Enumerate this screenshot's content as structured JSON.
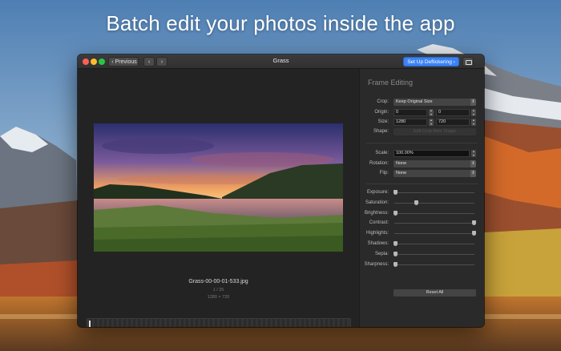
{
  "headline": "Batch edit your photos inside the app",
  "window": {
    "title": "Grass",
    "previous_label": "‹ Previous",
    "nav_back": "‹",
    "nav_forward": "›",
    "setup_label": "Set Up Deflickering ›"
  },
  "viewer": {
    "file_name": "Grass-00-00-01-533.jpg",
    "frame_counter": "1 / 25",
    "dimensions": "1280 × 720"
  },
  "panel": {
    "title": "Frame Editing",
    "crop_label": "Crop:",
    "crop_value": "Keep Original Size",
    "origin_label": "Origin:",
    "origin_x": "0",
    "origin_y": "0",
    "size_label": "Size:",
    "size_w": "1280",
    "size_h": "720",
    "shape_label": "Shape:",
    "shape_button": "Edit Crop Rect Shape",
    "scale_label": "Scale:",
    "scale_value": "100.00%",
    "rotation_label": "Rotation:",
    "rotation_value": "None",
    "flip_label": "Flip:",
    "flip_value": "None",
    "reset_label": "Reset All",
    "sliders": [
      {
        "label": "Exposure:",
        "value": 0.0
      },
      {
        "label": "Saturation:",
        "value": 0.27
      },
      {
        "label": "Brightness:",
        "value": 0.0
      },
      {
        "label": "Contrast:",
        "value": 1.0
      },
      {
        "label": "Highlights:",
        "value": 1.0
      },
      {
        "label": "Shadows:",
        "value": 0.0
      },
      {
        "label": "Sepia:",
        "value": 0.0
      },
      {
        "label": "Sharpness:",
        "value": 0.0
      }
    ]
  },
  "colors": {
    "accent": "#3a82f6",
    "window_bg": "#252525",
    "panel_bg": "#2a2a2a"
  }
}
